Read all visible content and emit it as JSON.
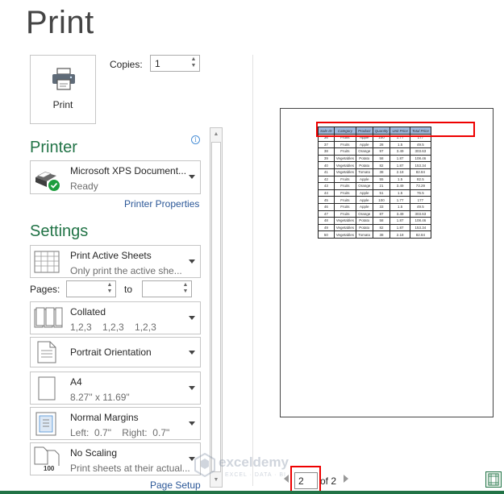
{
  "title": "Print",
  "print_button": {
    "label": "Print"
  },
  "copies": {
    "label": "Copies:",
    "value": "1"
  },
  "printer": {
    "heading": "Printer",
    "name": "Microsoft XPS Document...",
    "status": "Ready",
    "properties_link": "Printer Properties"
  },
  "settings": {
    "heading": "Settings",
    "scope": {
      "main": "Print Active Sheets",
      "sub": "Only print the active she..."
    },
    "pages": {
      "label": "Pages:",
      "from": "",
      "to_label": "to",
      "to": ""
    },
    "collation": {
      "main": "Collated",
      "sub": "1,2,3    1,2,3    1,2,3"
    },
    "orientation": {
      "main": "Portrait Orientation"
    },
    "paper": {
      "main": "A4",
      "sub": "8.27\" x 11.69\""
    },
    "margins": {
      "main": "Normal Margins",
      "sub": "Left:  0.7\"    Right:  0.7\""
    },
    "scaling": {
      "main": "No Scaling",
      "sub": "Print sheets at their actual...",
      "icon_text": "100"
    },
    "page_setup_link": "Page Setup"
  },
  "preview": {
    "headers": [
      "Sale ID",
      "Category",
      "Product",
      "Quantity",
      "Unit Price",
      "Total Price"
    ],
    "rows": [
      [
        "36",
        "Fruits",
        "Apple",
        "100",
        "1.77",
        "177"
      ],
      [
        "37",
        "Fruits",
        "Apple",
        "28",
        "1.5",
        "49.5"
      ],
      [
        "38",
        "Fruits",
        "Orange",
        "97",
        "3.49",
        "303.63"
      ],
      [
        "39",
        "Vegetables",
        "Potato",
        "58",
        "1.87",
        "108.46"
      ],
      [
        "40",
        "Vegetables",
        "Potato",
        "82",
        "1.87",
        "153.34"
      ],
      [
        "41",
        "Vegetables",
        "Tomato",
        "38",
        "2.18",
        "82.84"
      ],
      [
        "42",
        "Fruits",
        "Apple",
        "55",
        "1.5",
        "82.5"
      ],
      [
        "43",
        "Fruits",
        "Orange",
        "21",
        "3.49",
        "73.29"
      ],
      [
        "44",
        "Fruits",
        "Apple",
        "51",
        "1.5",
        "76.5"
      ],
      [
        "45",
        "Fruits",
        "Apple",
        "100",
        "1.77",
        "177"
      ],
      [
        "46",
        "Fruits",
        "Apple",
        "33",
        "1.5",
        "49.5"
      ],
      [
        "47",
        "Fruits",
        "Orange",
        "87",
        "3.49",
        "303.63"
      ],
      [
        "48",
        "Vegetables",
        "Potato",
        "58",
        "1.87",
        "108.46"
      ],
      [
        "49",
        "Vegetables",
        "Potato",
        "82",
        "1.87",
        "153.34"
      ],
      [
        "50",
        "Vegetables",
        "Tomato",
        "38",
        "2.18",
        "82.84"
      ]
    ]
  },
  "navigation": {
    "current_page": "2",
    "of_label": "of 2"
  },
  "watermark": {
    "brand": "exceldemy",
    "tagline": "EXCEL · DATA · BI"
  },
  "colors": {
    "accent": "#217346",
    "link": "#2b5797",
    "highlight": "#e00000",
    "header_fill": "#9db9dd"
  }
}
